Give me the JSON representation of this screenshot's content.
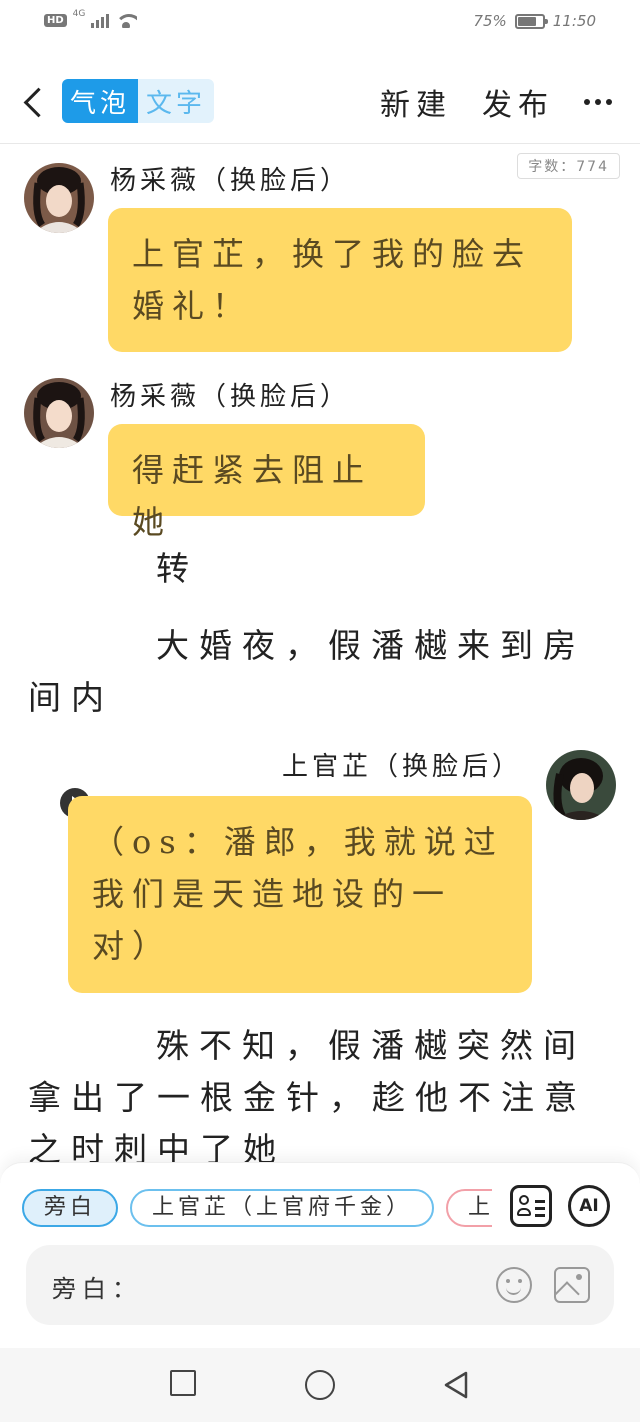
{
  "status_bar": {
    "hd": "HD",
    "network": "4G",
    "battery_text": "75%",
    "battery_level": 0.75,
    "time": "11:50"
  },
  "toolbar": {
    "mode_bubble": "气泡",
    "mode_text": "文字",
    "new_label": "新建",
    "publish_label": "发布"
  },
  "word_count": "字数：774",
  "messages": [
    {
      "speaker": "杨采薇（换脸后）",
      "text": "上官芷，换了我的脸去婚礼！"
    },
    {
      "speaker": "杨采薇（换脸后）",
      "text": "得赶紧去阻止她"
    },
    {
      "narration": "转"
    },
    {
      "narration": "大婚夜，假潘樾来到房间内"
    },
    {
      "speaker": "上官芷（换脸后）",
      "text": "（os：潘郎，我就说过我们是天造地设的一对）"
    },
    {
      "narration": "殊不知，假潘樾突然间拿出了一根金针，趁他不注意之时刺中了她"
    }
  ],
  "characters": [
    "旁白",
    "上官芷（上官府千金）",
    "上"
  ],
  "input": {
    "label": "旁白："
  },
  "colors": {
    "accent": "#1e9be8",
    "bubble": "#ffd966"
  }
}
